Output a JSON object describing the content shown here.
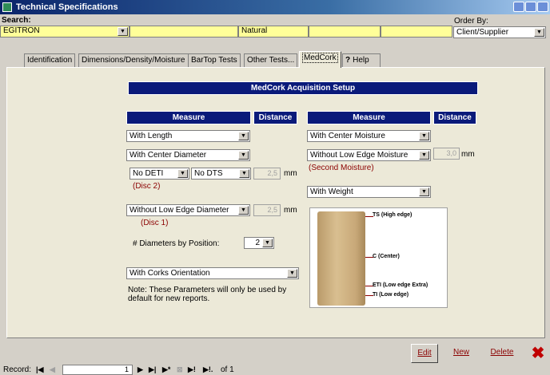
{
  "window": {
    "title": "Technical Specifications"
  },
  "search": {
    "label": "Search:",
    "supplier_value": "EGITRON",
    "type_value": "Natural"
  },
  "order_by": {
    "label": "Order By:",
    "value": "Client/Supplier"
  },
  "tabs": [
    "Identification",
    "Dimensions/Density/Moisture",
    "BarTop Tests",
    "Other Tests...",
    "MedCork",
    "Help"
  ],
  "panel": {
    "title": "MedCork Acquisition Setup"
  },
  "left": {
    "measure_header": "Measure",
    "distance_header": "Distance",
    "length": "With Length",
    "center_diameter": "With Center Diameter",
    "deti": "No DETI",
    "dts": "No DTS",
    "deti_value": "2,5",
    "deti_unit": "mm",
    "disc2": "(Disc 2)",
    "low_edge_diameter": "Without Low Edge Diameter",
    "low_edge_value": "2,5",
    "low_edge_unit": "mm",
    "disc1": "(Disc 1)",
    "diam_by_pos_label": "# Diameters by Position:",
    "diam_by_pos_value": "2",
    "orientation": "With Corks Orientation",
    "note": "Note: These Parameters will only be used by default for new reports."
  },
  "right": {
    "measure_header": "Measure",
    "distance_header": "Distance",
    "center_moisture": "With Center Moisture",
    "low_edge_moisture": "Without Low Edge Moisture",
    "low_edge_moisture_value": "3,0",
    "low_edge_moisture_unit": "mm",
    "second_moisture": "(Second Moisture)",
    "weight": "With Weight"
  },
  "cork_labels": {
    "ts": "TS (High edge)",
    "c": "C (Center)",
    "eti": "ETI (Low edge Extra)",
    "ti": "TI (Low edge)"
  },
  "buttons": {
    "edit": "Edit",
    "new": "New",
    "delete": "Delete"
  },
  "record": {
    "label": "Record:",
    "value": "1",
    "of_text": "of 1"
  },
  "colors": {
    "header": "#0a1a7a",
    "yellow": "#ffff99",
    "red": "#8b0000"
  }
}
